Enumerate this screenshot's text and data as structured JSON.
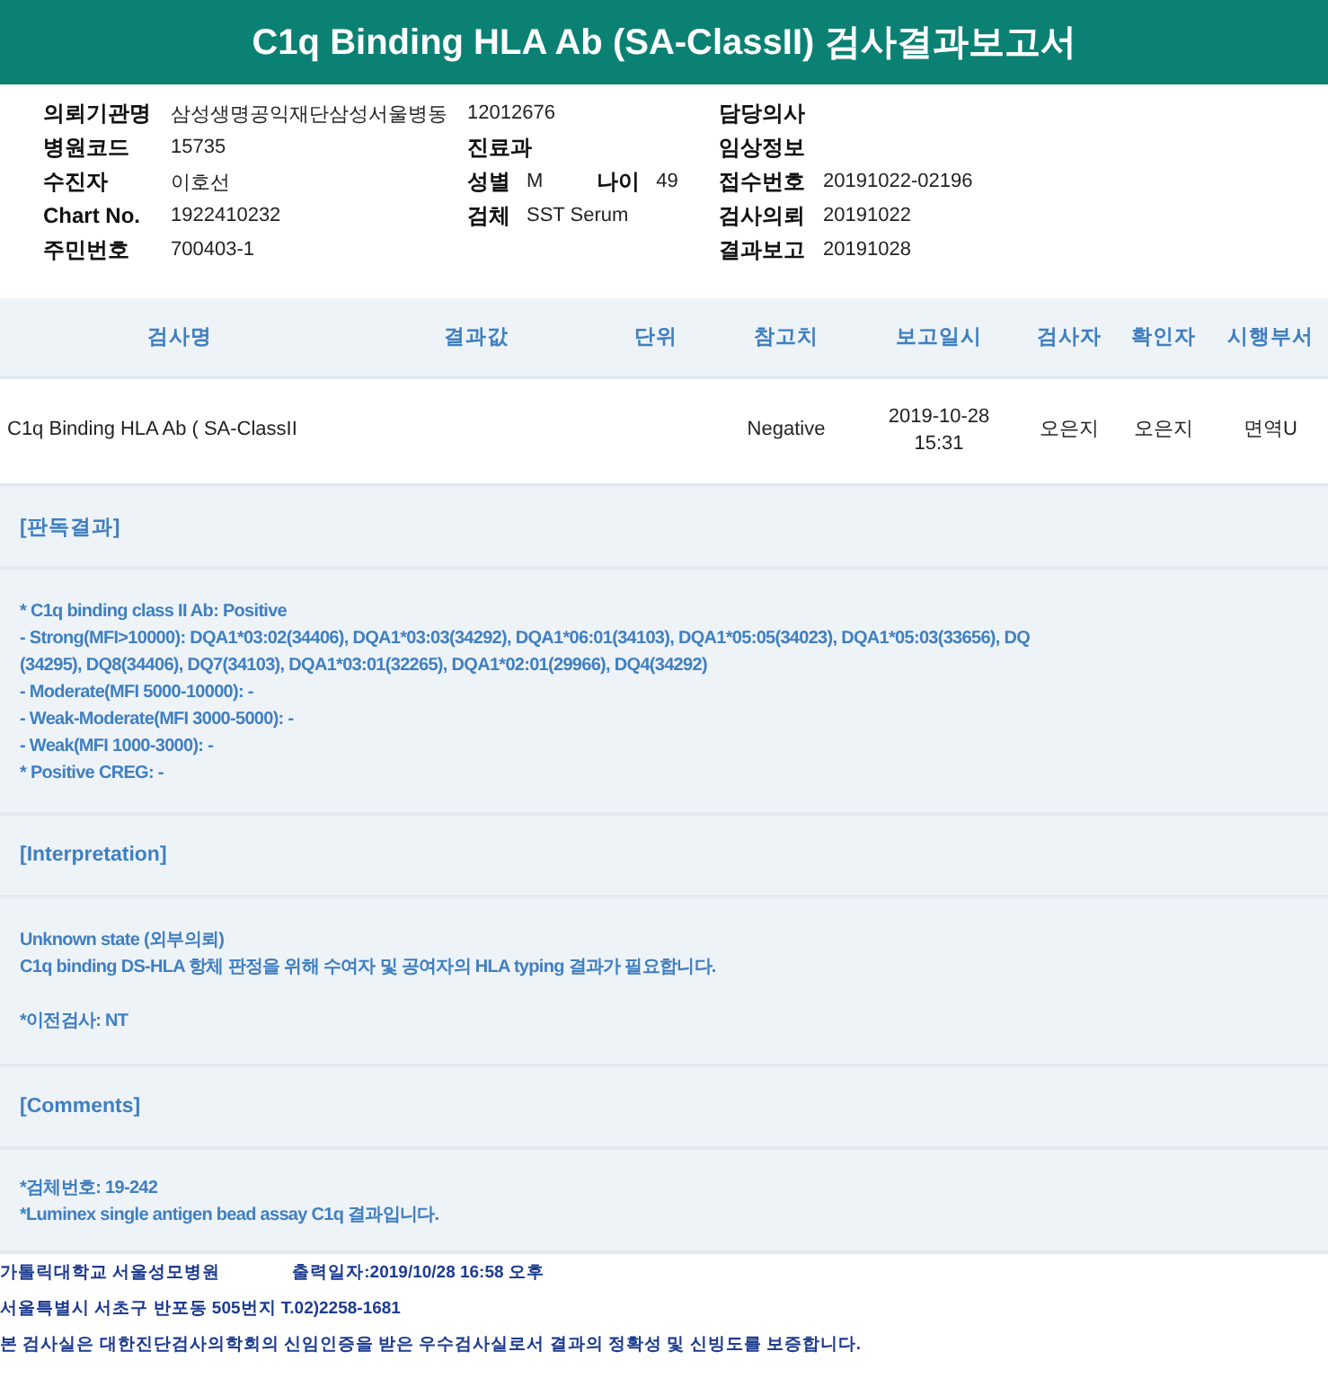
{
  "title": "C1q Binding HLA Ab (SA-ClassII) 검사결과보고서",
  "info_rows": [
    {
      "left": {
        "label": "의뢰기관명",
        "value": "삼성생명공익재단삼성서울병동"
      },
      "middle": [
        {
          "value": "12012676"
        }
      ],
      "right": {
        "label": "담당의사"
      }
    },
    {
      "left": {
        "label": "병원코드",
        "value": "15735"
      },
      "middle": [
        {
          "label": "진료과"
        }
      ],
      "right": {
        "label": "임상정보"
      }
    },
    {
      "left": {
        "label": "수진자",
        "value": "이호선"
      },
      "middle": [
        {
          "label": "성별",
          "value": "M"
        },
        {
          "label": "나이",
          "value": "49"
        }
      ],
      "right": {
        "label": "접수번호",
        "value": "20191022-02196"
      }
    },
    {
      "left": {
        "label": "Chart No.",
        "value": "1922410232"
      },
      "middle": [
        {
          "label": "검체",
          "value": "SST Serum"
        }
      ],
      "right": {
        "label": "검사의뢰",
        "value": "20191022"
      }
    },
    {
      "left": {
        "label": "주민번호",
        "value": "700403-1"
      },
      "middle": [],
      "right": {
        "label": "결과보고",
        "value": "20191028"
      }
    }
  ],
  "table": {
    "columns": [
      "검사명",
      "결과값",
      "단위",
      "참고치",
      "보고일시",
      "검사자",
      "확인자",
      "시행부서"
    ],
    "rows": [
      [
        "C1q Binding HLA Ab ( SA-ClassII",
        "",
        "",
        "Negative",
        "2019-10-28\n15:31",
        "오은지",
        "오은지",
        "면역U"
      ]
    ]
  },
  "sections": [
    {
      "heading": "[판독결과]",
      "paragraphs": [
        [
          "* C1q binding class II Ab: Positive",
          "- Strong(MFI>10000): DQA1*03:02(34406), DQA1*03:03(34292), DQA1*06:01(34103), DQA1*05:05(34023), DQA1*05:03(33656), DQ",
          "(34295), DQ8(34406), DQ7(34103), DQA1*03:01(32265), DQA1*02:01(29966), DQ4(34292)",
          "- Moderate(MFI 5000-10000): -",
          "- Weak-Moderate(MFI 3000-5000): -",
          "- Weak(MFI 1000-3000): -",
          "* Positive CREG: -"
        ]
      ]
    },
    {
      "heading": "[Interpretation]",
      "paragraphs": [
        [
          "Unknown state (외부의뢰)",
          "C1q binding DS-HLA 항체 판정을 위해 수여자 및 공여자의 HLA typing 결과가 필요합니다."
        ],
        [
          "*이전검사: NT"
        ]
      ]
    },
    {
      "heading": "[Comments]",
      "paragraphs": [
        [
          "*검체번호: 19-242",
          "*Luminex single antigen bead assay C1q 결과입니다."
        ]
      ]
    }
  ],
  "footer": {
    "hospital": "가톨릭대학교 서울성모병원",
    "printed": "출력일자:2019/10/28 16:58 오후",
    "address": "서울특별시 서초구 반포동 505번지 T.02)2258-1681",
    "certification": "본 검사실은 대한진단검사의학회의 신임인증을 받은 우수검사실로서 결과의 정확성 및 신빙도를 보증합니다."
  }
}
